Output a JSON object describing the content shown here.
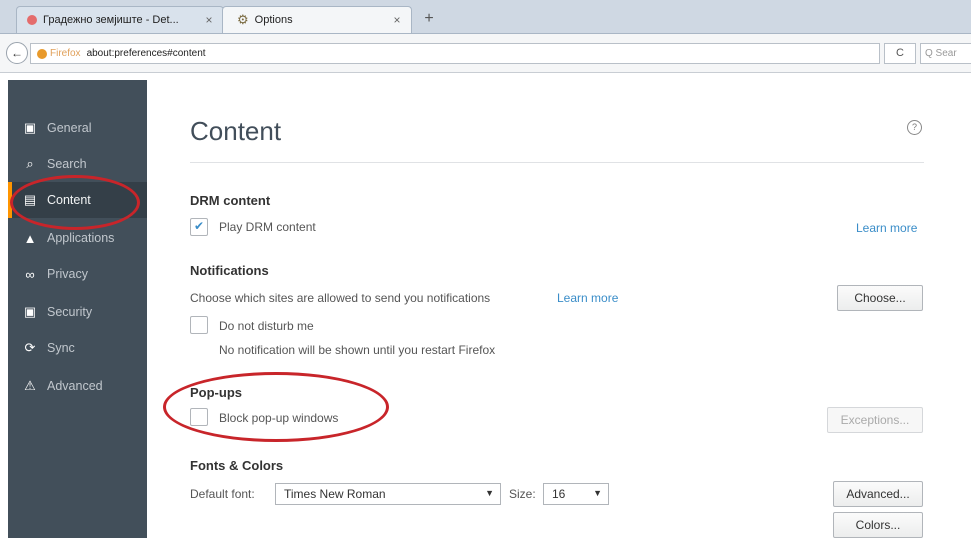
{
  "tabs": [
    {
      "title": "Градежно земјиште - Det...",
      "close": "×"
    },
    {
      "title": "Options",
      "close": "×"
    }
  ],
  "new_tab": "+",
  "navbar": {
    "brand": "Firefox",
    "url": "about:preferences#content",
    "reload": "C",
    "search_placeholder": "Q Sear"
  },
  "sidebar": {
    "items": [
      {
        "label": "General",
        "icon": "general-icon",
        "glyph": "▣"
      },
      {
        "label": "Search",
        "icon": "search-icon",
        "glyph": "🔍"
      },
      {
        "label": "Content",
        "icon": "content-icon",
        "glyph": "▤",
        "selected": true
      },
      {
        "label": "Applications",
        "icon": "applications-icon",
        "glyph": "▲"
      },
      {
        "label": "Privacy",
        "icon": "privacy-icon",
        "glyph": "∞"
      },
      {
        "label": "Security",
        "icon": "security-icon",
        "glyph": "🔒"
      },
      {
        "label": "Sync",
        "icon": "sync-icon",
        "glyph": "⟳"
      },
      {
        "label": "Advanced",
        "icon": "advanced-icon",
        "glyph": "⚠"
      }
    ]
  },
  "main": {
    "title": "Content",
    "help": "?",
    "drm": {
      "heading": "DRM content",
      "checkbox_label": "Play DRM content",
      "checked": true,
      "learn_more": "Learn more"
    },
    "notifications": {
      "heading": "Notifications",
      "description": "Choose which sites are allowed to send you notifications",
      "learn_more": "Learn more",
      "choose_button": "Choose...",
      "dnd_label": "Do not disturb me",
      "dnd_note": "No notification will be shown until you restart Firefox"
    },
    "popups": {
      "heading": "Pop-ups",
      "block_label": "Block pop-up windows",
      "exceptions_button": "Exceptions..."
    },
    "fonts": {
      "heading": "Fonts & Colors",
      "default_font_label": "Default font:",
      "default_font_value": "Times New Roman",
      "size_label": "Size:",
      "size_value": "16",
      "advanced_button": "Advanced...",
      "colors_button": "Colors..."
    }
  },
  "colors": {
    "sidebar_bg": "#424f5a",
    "accent": "#ff9500",
    "link": "#3a8dc8",
    "annotation_ring": "#c8252a"
  }
}
